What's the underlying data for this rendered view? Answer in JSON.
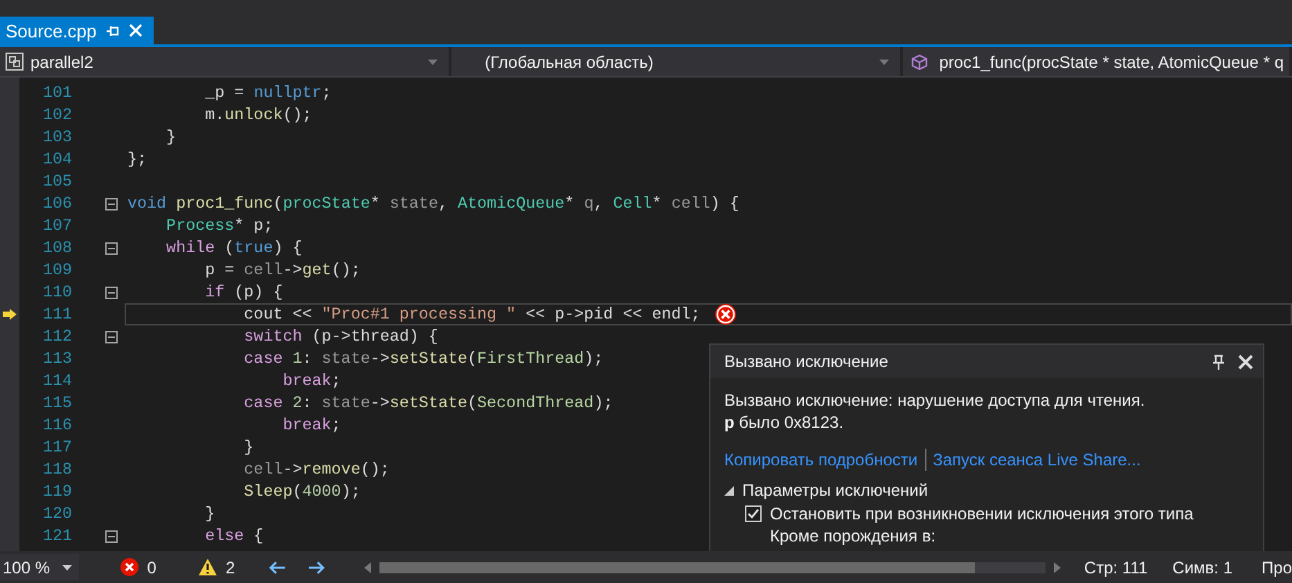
{
  "tab": {
    "title": "Source.cpp",
    "selected": true
  },
  "navigation": {
    "project": "parallel2",
    "scope": "(Глобальная область)",
    "member": "proc1_func(procState * state, AtomicQueue * q"
  },
  "lines": [
    {
      "number": "101",
      "fold": false,
      "current": false,
      "tokens": [
        {
          "kind": "plain",
          "t": "        _p = "
        },
        {
          "kind": "keyword",
          "t": "nullptr"
        },
        {
          "kind": "plain",
          "t": ";"
        }
      ]
    },
    {
      "number": "102",
      "fold": false,
      "current": false,
      "tokens": [
        {
          "kind": "plain",
          "t": "        m."
        },
        {
          "kind": "func",
          "t": "unlock"
        },
        {
          "kind": "plain",
          "t": "();"
        }
      ]
    },
    {
      "number": "103",
      "fold": false,
      "current": false,
      "tokens": [
        {
          "kind": "plain",
          "t": "    }"
        }
      ]
    },
    {
      "number": "104",
      "fold": false,
      "current": false,
      "tokens": [
        {
          "kind": "plain",
          "t": "};"
        }
      ]
    },
    {
      "number": "105",
      "fold": false,
      "current": false
    },
    {
      "number": "106",
      "fold": true,
      "current": false,
      "tokens": [
        {
          "kind": "keyword",
          "t": "void"
        },
        {
          "kind": "func",
          "t": " proc1_func"
        },
        {
          "kind": "plain",
          "t": "("
        },
        {
          "kind": "type",
          "t": "procState"
        },
        {
          "kind": "plain",
          "t": "* "
        },
        {
          "kind": "param",
          "t": "state"
        },
        {
          "kind": "plain",
          "t": ", "
        },
        {
          "kind": "type",
          "t": "AtomicQueue"
        },
        {
          "kind": "plain",
          "t": "* "
        },
        {
          "kind": "param",
          "t": "q"
        },
        {
          "kind": "plain",
          "t": ", "
        },
        {
          "kind": "type",
          "t": "Cell"
        },
        {
          "kind": "plain",
          "t": "* "
        },
        {
          "kind": "param",
          "t": "cell"
        },
        {
          "kind": "plain",
          "t": ") {"
        }
      ]
    },
    {
      "number": "107",
      "fold": false,
      "current": false,
      "tokens": [
        {
          "kind": "type",
          "t": "    Process"
        },
        {
          "kind": "plain",
          "t": "* p;"
        }
      ]
    },
    {
      "number": "108",
      "fold": true,
      "current": false,
      "tokens": [
        {
          "kind": "control",
          "t": "    while"
        },
        {
          "kind": "plain",
          "t": " ("
        },
        {
          "kind": "keyword",
          "t": "true"
        },
        {
          "kind": "plain",
          "t": ") {"
        }
      ]
    },
    {
      "number": "109",
      "fold": false,
      "current": false,
      "tokens": [
        {
          "kind": "plain",
          "t": "        p = "
        },
        {
          "kind": "param",
          "t": "cell"
        },
        {
          "kind": "plain",
          "t": "->"
        },
        {
          "kind": "func",
          "t": "get"
        },
        {
          "kind": "plain",
          "t": "();"
        }
      ]
    },
    {
      "number": "110",
      "fold": true,
      "current": false,
      "tokens": [
        {
          "kind": "control",
          "t": "        if"
        },
        {
          "kind": "plain",
          "t": " (p) {"
        }
      ]
    },
    {
      "number": "111",
      "fold": false,
      "current": true,
      "tokens": [
        {
          "kind": "plain",
          "t": "            cout << "
        },
        {
          "kind": "string",
          "t": "\"Proc#1 processing \""
        },
        {
          "kind": "plain",
          "t": " << p->pid << endl;"
        }
      ]
    },
    {
      "number": "112",
      "fold": true,
      "current": false,
      "tokens": [
        {
          "kind": "control",
          "t": "            switch"
        },
        {
          "kind": "plain",
          "t": " (p->thread) {"
        }
      ]
    },
    {
      "number": "113",
      "fold": false,
      "current": false,
      "tokens": [
        {
          "kind": "control",
          "t": "            case"
        },
        {
          "kind": "number",
          "t": " 1"
        },
        {
          "kind": "plain",
          "t": ": "
        },
        {
          "kind": "param",
          "t": "state"
        },
        {
          "kind": "plain",
          "t": "->"
        },
        {
          "kind": "func",
          "t": "setState"
        },
        {
          "kind": "plain",
          "t": "("
        },
        {
          "kind": "enum",
          "t": "FirstThread"
        },
        {
          "kind": "plain",
          "t": ");"
        }
      ]
    },
    {
      "number": "114",
      "fold": false,
      "current": false,
      "tokens": [
        {
          "kind": "control",
          "t": "                break"
        },
        {
          "kind": "plain",
          "t": ";"
        }
      ]
    },
    {
      "number": "115",
      "fold": false,
      "current": false,
      "tokens": [
        {
          "kind": "control",
          "t": "            case"
        },
        {
          "kind": "number",
          "t": " 2"
        },
        {
          "kind": "plain",
          "t": ": "
        },
        {
          "kind": "param",
          "t": "state"
        },
        {
          "kind": "plain",
          "t": "->"
        },
        {
          "kind": "func",
          "t": "setState"
        },
        {
          "kind": "plain",
          "t": "("
        },
        {
          "kind": "enum",
          "t": "SecondThread"
        },
        {
          "kind": "plain",
          "t": ");"
        }
      ]
    },
    {
      "number": "116",
      "fold": false,
      "current": false,
      "tokens": [
        {
          "kind": "control",
          "t": "                break"
        },
        {
          "kind": "plain",
          "t": ";"
        }
      ]
    },
    {
      "number": "117",
      "fold": false,
      "current": false,
      "tokens": [
        {
          "kind": "plain",
          "t": "            }"
        }
      ]
    },
    {
      "number": "118",
      "fold": false,
      "current": false,
      "tokens": [
        {
          "kind": "param",
          "t": "            cell"
        },
        {
          "kind": "plain",
          "t": "->"
        },
        {
          "kind": "func",
          "t": "remove"
        },
        {
          "kind": "plain",
          "t": "();"
        }
      ]
    },
    {
      "number": "119",
      "fold": false,
      "current": false,
      "tokens": [
        {
          "kind": "func",
          "t": "            Sleep"
        },
        {
          "kind": "plain",
          "t": "("
        },
        {
          "kind": "number",
          "t": "4000"
        },
        {
          "kind": "plain",
          "t": ");"
        }
      ]
    },
    {
      "number": "120",
      "fold": false,
      "current": false,
      "tokens": [
        {
          "kind": "plain",
          "t": "        }"
        }
      ]
    },
    {
      "number": "121",
      "fold": true,
      "current": false,
      "tokens": [
        {
          "kind": "control",
          "t": "        else"
        },
        {
          "kind": "plain",
          "t": " {"
        }
      ]
    }
  ],
  "exception_popup": {
    "title": "Вызвано исключение",
    "message": "Вызвано исключение: нарушение доступа для чтения.",
    "detail": "**p** было 0x8123.",
    "links": [
      "Копировать подробности",
      "Запуск сеанса Live Share..."
    ],
    "settings": {
      "title": "Параметры исключений",
      "expanded": true,
      "checkbox": {
        "label": "Остановить при возникновении исключения этого типа",
        "checked": true
      },
      "note": "Кроме порождения в:"
    }
  },
  "status_bar": {
    "zoom": "100 %",
    "errors": "0",
    "warnings": "2",
    "line": "Стр: 111",
    "column": "Симв: 1",
    "extra": "Про"
  }
}
